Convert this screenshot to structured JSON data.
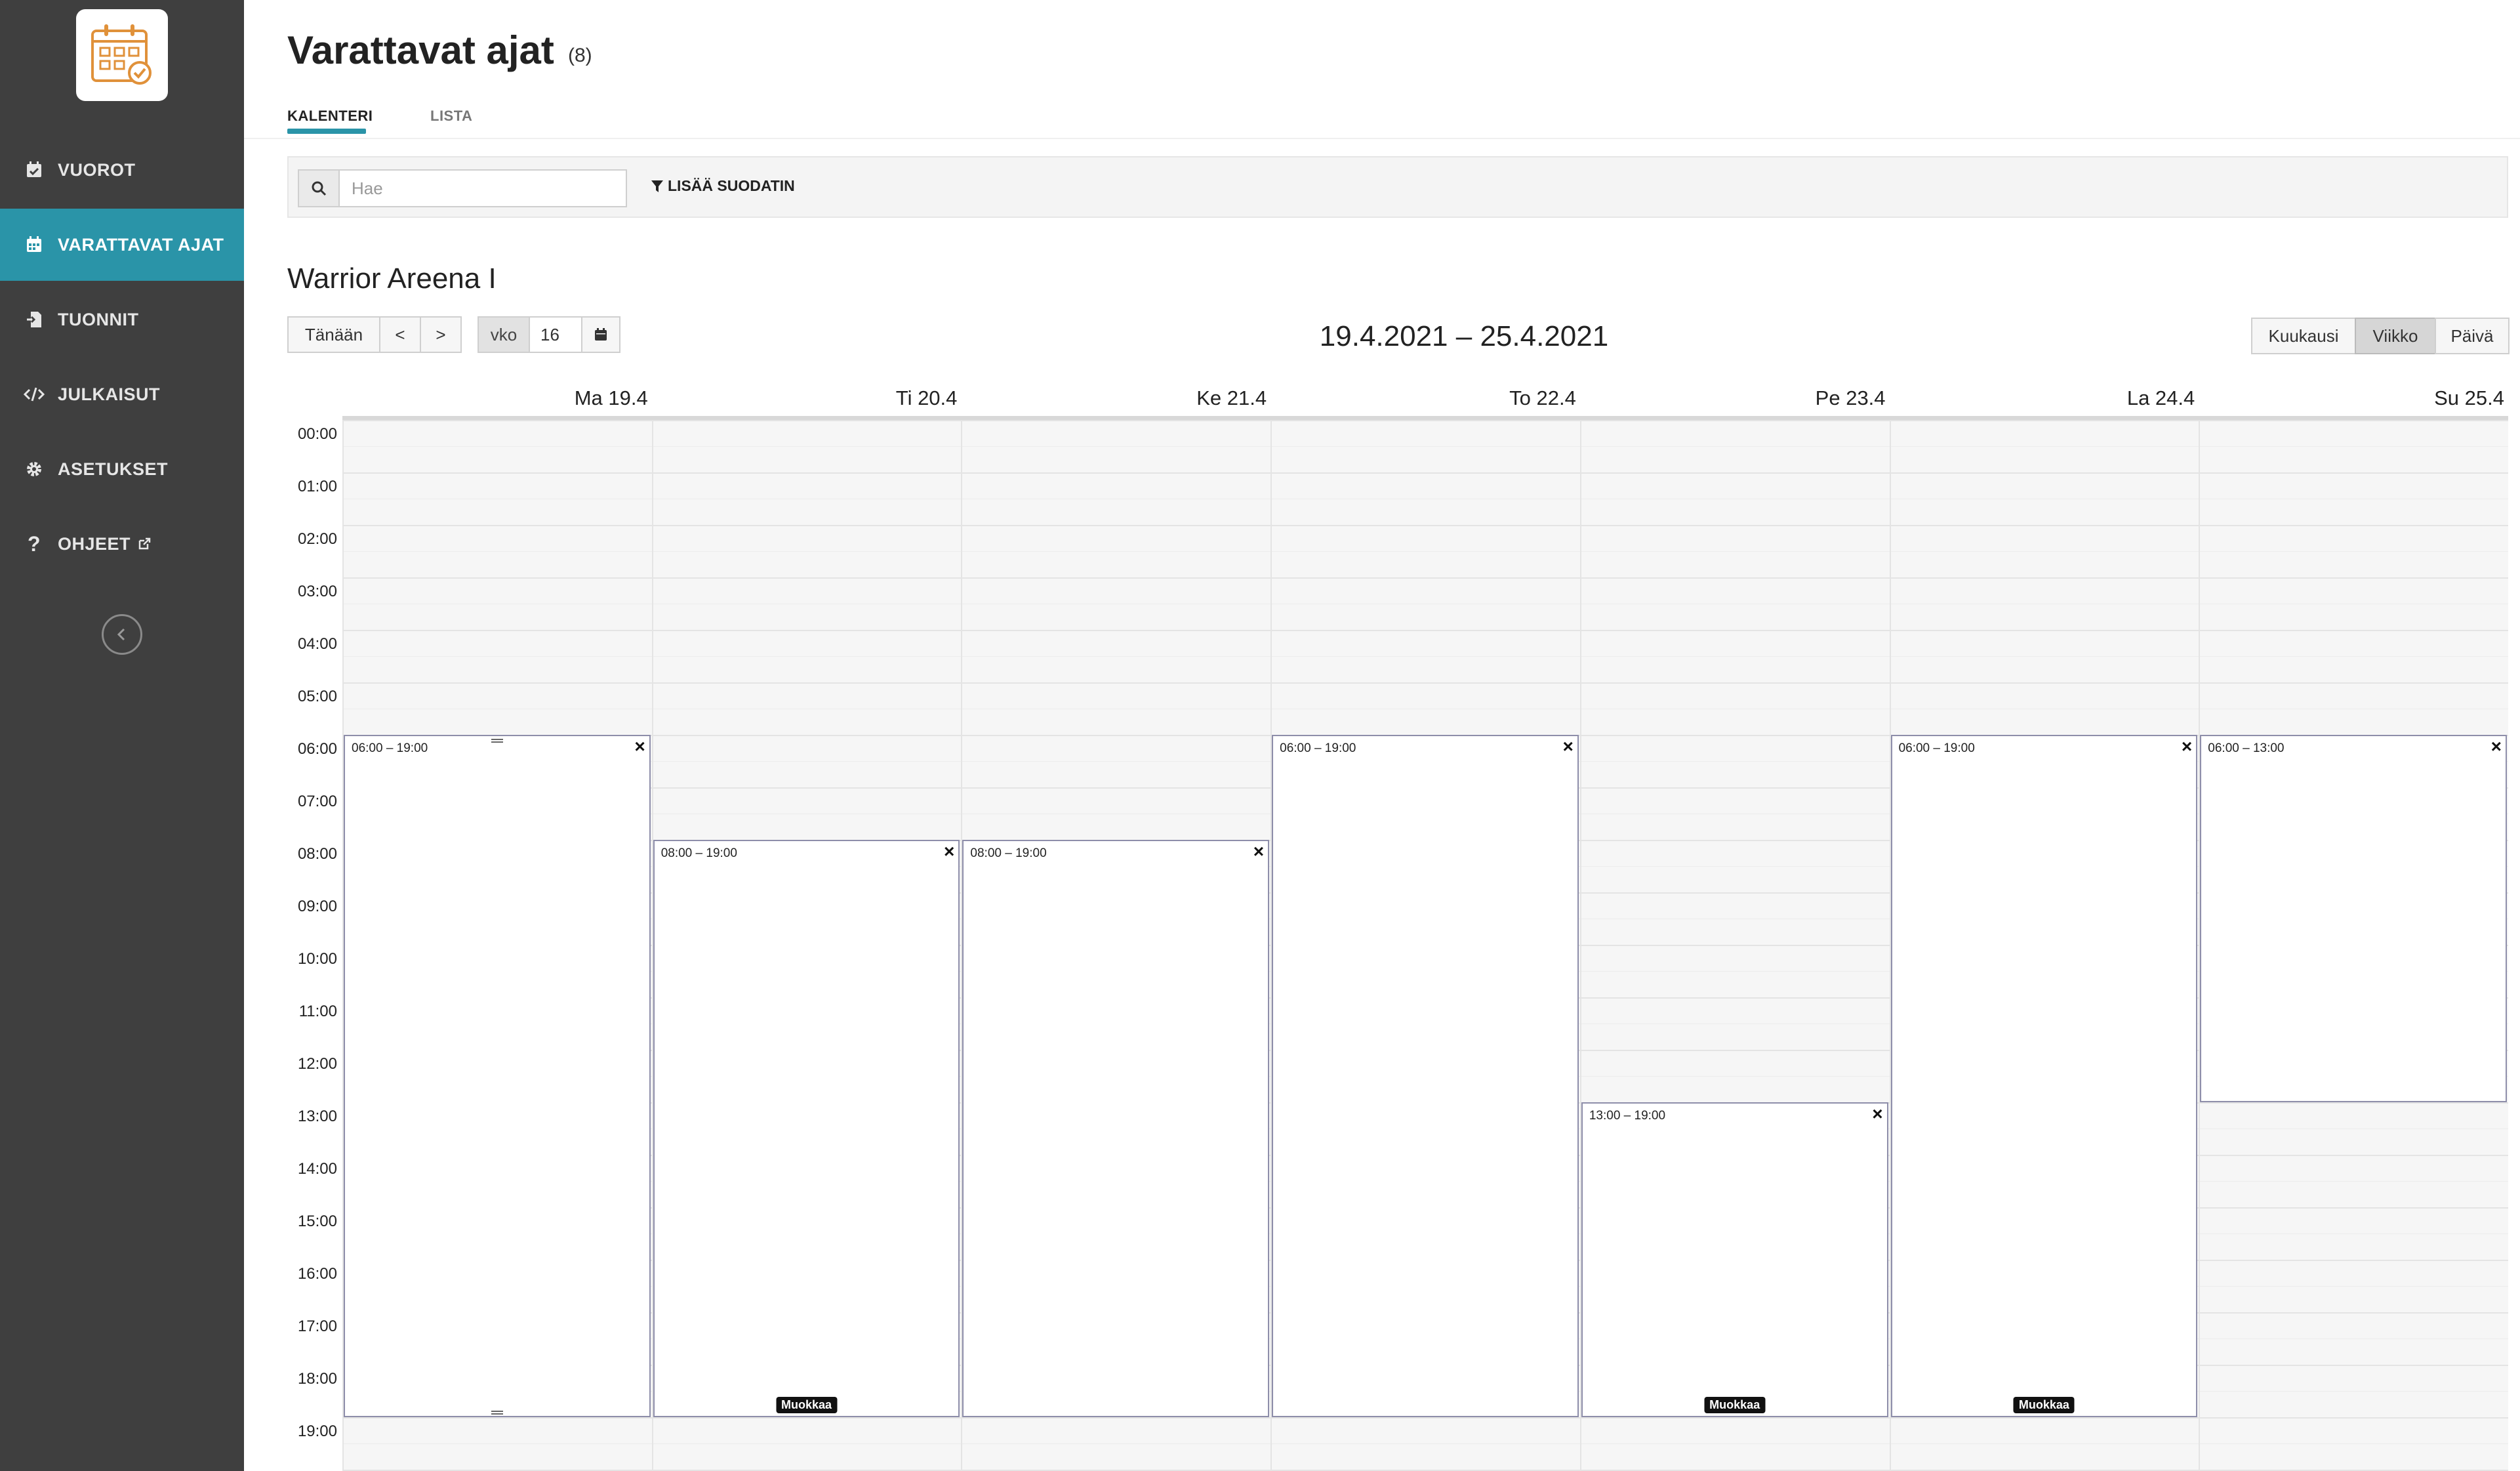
{
  "sidebar": {
    "items": [
      {
        "label": "VUOROT",
        "icon": "calendar-check-icon"
      },
      {
        "label": "VARATTAVAT AJAT",
        "icon": "calendar-grid-icon"
      },
      {
        "label": "TUONNIT",
        "icon": "file-import-icon"
      },
      {
        "label": "JULKAISUT",
        "icon": "code-icon"
      },
      {
        "label": "ASETUKSET",
        "icon": "gear-icon"
      },
      {
        "label": "OHJEET",
        "icon": "question-icon"
      }
    ],
    "active_index": 1
  },
  "header": {
    "title": "Varattavat ajat",
    "count": "(8)"
  },
  "tabs": [
    {
      "label": "KALENTERI",
      "active": true
    },
    {
      "label": "LISTA",
      "active": false
    }
  ],
  "filter": {
    "search_placeholder": "Hae",
    "add_filter_label": "LISÄÄ SUODATIN"
  },
  "venue": "Warrior Areena I",
  "toolbar": {
    "today": "Tänään",
    "prev": "<",
    "next": ">",
    "week_label": "vko",
    "week_value": "16",
    "range": "19.4.2021 – 25.4.2021",
    "views": [
      "Kuukausi",
      "Viikko",
      "Päivä"
    ],
    "active_view": "Viikko"
  },
  "calendar": {
    "days": [
      "Ma 19.4",
      "Ti 20.4",
      "Ke 21.4",
      "To 22.4",
      "Pe 23.4",
      "La 24.4",
      "Su 25.4"
    ],
    "hours": [
      "00:00",
      "01:00",
      "02:00",
      "03:00",
      "04:00",
      "05:00",
      "06:00",
      "07:00",
      "08:00",
      "09:00",
      "10:00",
      "11:00",
      "12:00",
      "13:00",
      "14:00",
      "15:00",
      "16:00",
      "17:00",
      "18:00",
      "19:00"
    ],
    "slots": [
      {
        "day": 0,
        "start": 6,
        "end": 19,
        "label": "06:00 – 19:00",
        "edit": false,
        "handles": true
      },
      {
        "day": 1,
        "start": 8,
        "end": 19,
        "label": "08:00 – 19:00",
        "edit": true
      },
      {
        "day": 2,
        "start": 8,
        "end": 19,
        "label": "08:00 – 19:00",
        "edit": false
      },
      {
        "day": 3,
        "start": 6,
        "end": 19,
        "label": "06:00 – 19:00",
        "edit": false
      },
      {
        "day": 4,
        "start": 13,
        "end": 19,
        "label": "13:00 – 19:00",
        "edit": true
      },
      {
        "day": 5,
        "start": 6,
        "end": 19,
        "label": "06:00 – 19:00",
        "edit": true
      },
      {
        "day": 6,
        "start": 6,
        "end": 13,
        "label": "06:00 – 13:00",
        "edit": false
      }
    ],
    "close_symbol": "×",
    "edit_label": "Muokkaa"
  }
}
